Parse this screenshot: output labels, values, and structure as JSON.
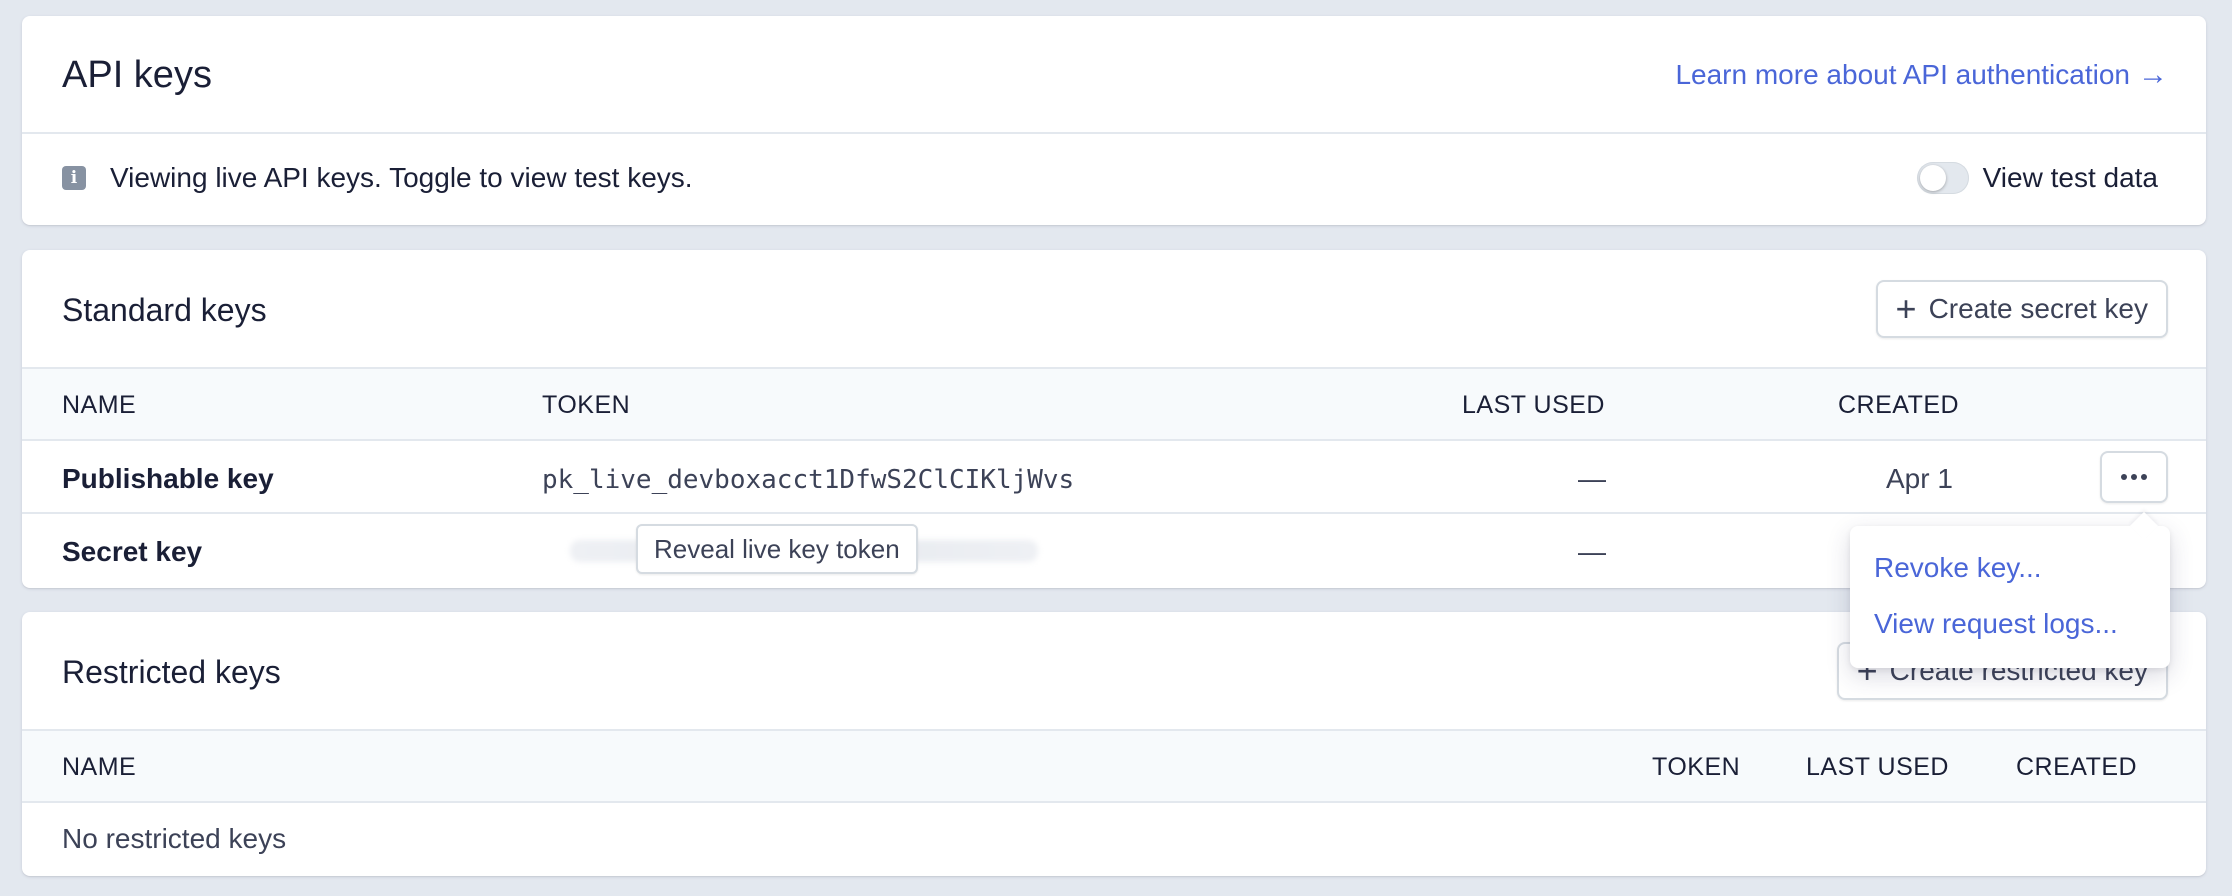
{
  "api": {
    "title": "API keys",
    "learn_link": "Learn more about API authentication",
    "learn_arrow": "→",
    "info_icon": "i",
    "info_text": "Viewing live API keys. Toggle to view test keys.",
    "toggle_label": "View test data",
    "toggle_on": false
  },
  "standard": {
    "title": "Standard keys",
    "create_button": "Create secret key",
    "columns": {
      "name": "NAME",
      "token": "TOKEN",
      "last_used": "LAST USED",
      "created": "CREATED"
    },
    "rows": [
      {
        "name": "Publishable key",
        "token": "pk_live_devboxacct1DfwS2ClCIKljWvs",
        "last_used": "—",
        "created": "Apr 1"
      },
      {
        "name": "Secret key",
        "reveal_label": "Reveal live key token",
        "last_used": "—"
      }
    ],
    "menu": {
      "items": [
        "Revoke key...",
        "View request logs..."
      ]
    }
  },
  "restricted": {
    "title": "Restricted keys",
    "create_button": "Create restricted key",
    "columns": {
      "name": "NAME",
      "token": "TOKEN",
      "last_used": "LAST USED",
      "created": "CREATED"
    },
    "empty_text": "No restricted keys"
  },
  "colors": {
    "accent": "#4a66d8",
    "background": "#e3e8ef",
    "text": "#1a1f36"
  },
  "icons": {
    "info": "info-icon",
    "plus": "plus-icon",
    "more": "more-horizontal-icon",
    "arrow": "arrow-right-icon"
  }
}
